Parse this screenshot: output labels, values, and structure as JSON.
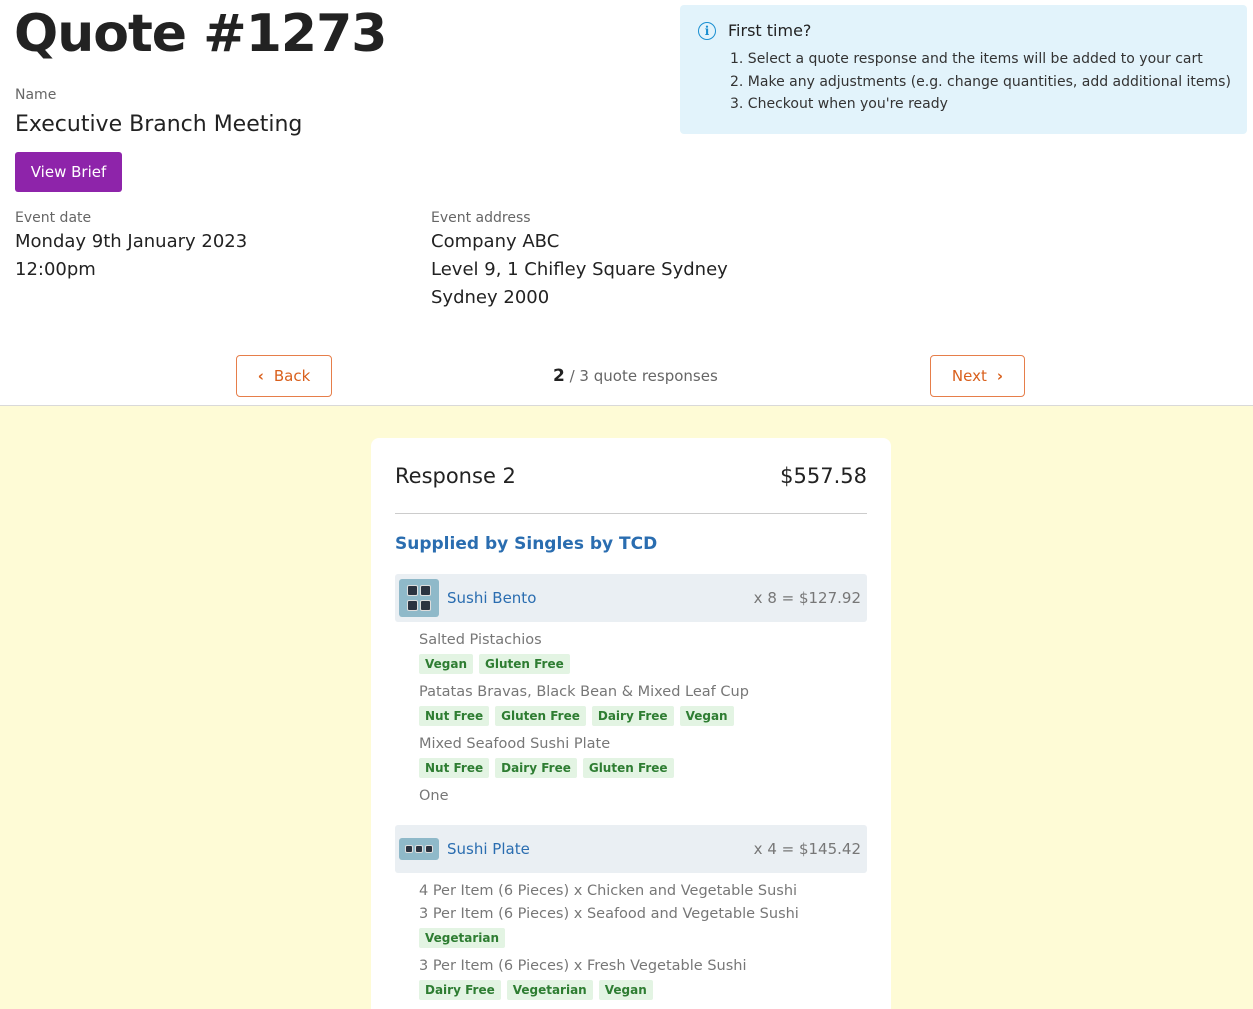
{
  "quote_title": "Quote #1273",
  "name_label": "Name",
  "name_value": "Executive Branch Meeting",
  "view_brief_label": "View Brief",
  "event_date_label": "Event date",
  "event_date": "Monday 9th January 2023",
  "event_time": "12:00pm",
  "event_address_label": "Event address",
  "address": {
    "line1": "Company ABC",
    "line2": "Level 9, 1 Chifley Square Sydney",
    "line3": "Sydney 2000"
  },
  "info": {
    "icon": "info-icon",
    "title": "First time?",
    "steps": [
      "1. Select a quote response and the items will be added to your cart",
      "2. Make any adjustments (e.g. change quantities, add additional items)",
      "3. Checkout when you're ready"
    ]
  },
  "nav": {
    "back_label": "Back",
    "next_label": "Next",
    "current": "2",
    "suffix": " / 3 quote responses"
  },
  "colors": {
    "accent_purple": "#8e24aa",
    "nav_orange": "#d9601d",
    "info_bg": "#e2f3fb",
    "yellow_bg": "#fefbd6",
    "link_blue": "#2a6db0",
    "tag_green": "#2e7d32"
  },
  "response": {
    "title": "Response 2",
    "total": "$557.58",
    "supplier": "Supplied by Singles by TCD",
    "items": [
      {
        "name": "Sushi Bento",
        "qty_price": "x 8 = $127.92",
        "subitems": [
          {
            "name": "Salted Pistachios",
            "tags": [
              "Vegan",
              "Gluten Free"
            ]
          },
          {
            "name": "Patatas Bravas, Black Bean & Mixed Leaf Cup",
            "tags": [
              "Nut Free",
              "Gluten Free",
              "Dairy Free",
              "Vegan"
            ]
          },
          {
            "name": "Mixed Seafood Sushi Plate",
            "tags": [
              "Nut Free",
              "Dairy Free",
              "Gluten Free"
            ]
          },
          {
            "name": "One",
            "tags": []
          }
        ]
      },
      {
        "name": "Sushi Plate",
        "qty_price": "x 4 = $145.42",
        "subitems": [
          {
            "name": "4 Per Item (6 Pieces) x Chicken and Vegetable Sushi",
            "tags": []
          },
          {
            "name": "3 Per Item (6 Pieces) x Seafood and Vegetable Sushi",
            "tags": [
              "Vegetarian"
            ]
          },
          {
            "name": "3 Per Item (6 Pieces) x Fresh Vegetable Sushi",
            "tags": [
              "Dairy Free",
              "Vegetarian",
              "Vegan"
            ]
          }
        ]
      }
    ]
  }
}
